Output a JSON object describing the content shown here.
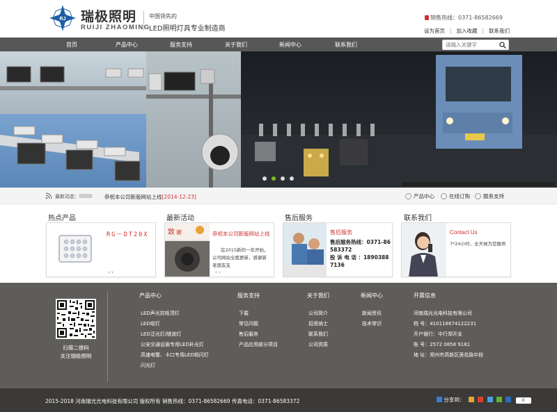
{
  "header": {
    "brand_cn": "瑞极照明",
    "brand_en": "RUIJI ZHAOMING",
    "slogan_line1": "中国领先的",
    "slogan_line2": "LED照明灯具专业制造商",
    "hotline": "销售热线：0371-86582669",
    "toplinks": [
      "设为首页",
      "加入收藏",
      "联系我们"
    ]
  },
  "nav": {
    "items": [
      "首页",
      "产品中心",
      "服务支持",
      "关于我们",
      "新闻中心",
      "联系我们"
    ],
    "search_placeholder": "请输入关键字"
  },
  "newsbar": {
    "label": "最新动态：",
    "text": "恭祝本公司新版网站上线",
    "date": "[2014-12-23]",
    "quick_links": [
      "产品中心",
      "在线订购",
      "服务支持"
    ]
  },
  "sections": {
    "hot_products": {
      "title": "热点产品",
      "product_name": "RG－DT20X"
    },
    "latest": {
      "title": "最新活动",
      "headline": "恭祝本公司新版网站上线",
      "body": "在2015新的一年开始，公司网站全面更新，感谢新老朋友支"
    },
    "after_sales": {
      "title": "售后服务",
      "card_title": "售后服务",
      "hotline_label": "售后服务热线：0371-86583372",
      "complaint_label": "投 诉 电 话 ：18903887136"
    },
    "contact": {
      "title": "联系我们",
      "card_title": "Contact Us",
      "text": "7*24小时，全天候为您服务"
    }
  },
  "footer": {
    "qr_caption": [
      "扫描二维码",
      "关注瑞极照明"
    ],
    "product_center": {
      "title": "产品中心",
      "items": [
        "LED声光控吸顶灯",
        "LED吸灯",
        "LED泛光灯/隧道灯",
        "公安交通设施专用LED补光灯",
        "高速电警、卡口专用LED频闪灯",
        "闪光灯"
      ]
    },
    "service": {
      "title": "服务支持",
      "items": [
        "下载",
        "常见问题",
        "售后服务",
        "产品应用部分项目"
      ]
    },
    "about": {
      "title": "关于我们",
      "items": [
        "公司简介",
        "招贤纳士",
        "联系我们",
        "公司资质"
      ]
    },
    "news": {
      "title": "新闻中心",
      "items": [
        "新闻资讯",
        "技术常识"
      ]
    },
    "invoice": {
      "title": "开票信息",
      "items": [
        "河南瑞光光电科技有限公司",
        "税 号：410118674122231",
        "开户银行：中行郑开支",
        "账 号：2572 0858 9181",
        "地 址：郑州市高新区莲花路中段"
      ]
    },
    "copyright": "2015-2018  河南瑞光光电科技有限公司  版权所有  销售热线：0371-86582669  传真电话：0371-86583372",
    "share_label": "分享到：",
    "share_count": "0"
  },
  "colors": {
    "nav_bg": "#575757",
    "footer_bg": "#5f5d5a",
    "bottom_bg": "#3b3a38",
    "accent_red": "#cc3333",
    "active_dot": "#7dbb2b"
  }
}
